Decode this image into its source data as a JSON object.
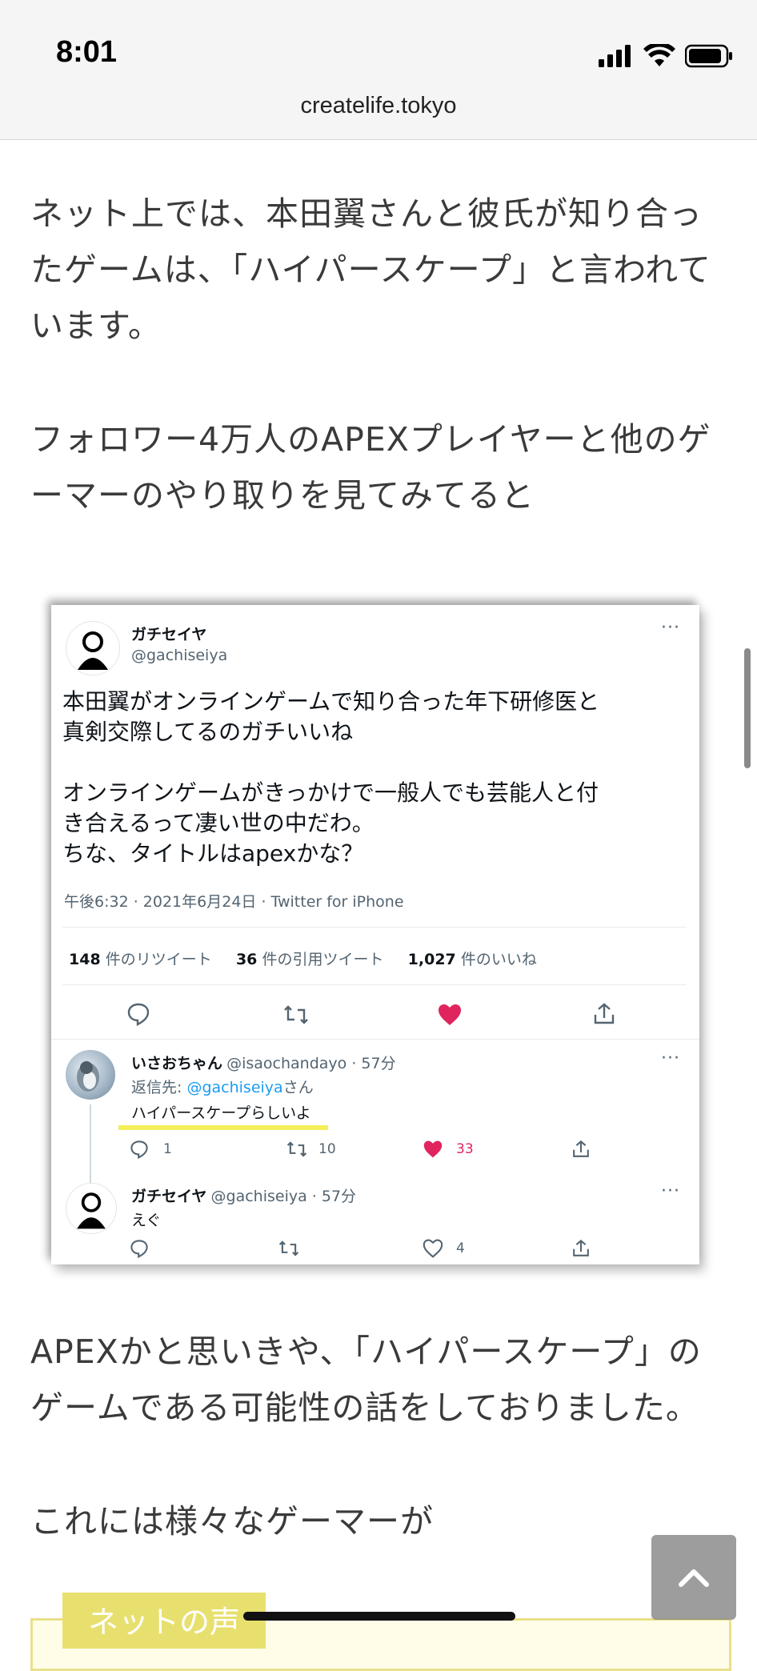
{
  "status_bar": {
    "time": "8:01",
    "battery_icon": "battery-icon",
    "wifi_icon": "wifi-icon",
    "signal_icon": "cellular-signal-icon"
  },
  "browser": {
    "url": "createlife.tokyo"
  },
  "article": {
    "para1": "ネット上では、本田翼さんと彼氏が知り合ったゲームは、「ハイパースケープ」と言われています。",
    "para2": "フォロワー4万人のAPEXプレイヤーと他のゲーマーのやり取りを見てみてると",
    "para3": "APEXかと思いきや、「ハイパースケープ」のゲームである可能性の話をしておりました。",
    "para4": "これには様々なゲーマーが"
  },
  "tweet": {
    "author_name": "ガチセイヤ",
    "author_handle": "@gachiseiya",
    "body_line1": "本田翼がオンラインゲームで知り合った年下研修医と",
    "body_line2": "真剣交際してるのガチいいね",
    "body_line3": "オンラインゲームがきっかけで一般人でも芸能人と付",
    "body_line4": "き合えるって凄い世の中だわ。",
    "body_line5": "ちな、タイトルはapexかな？",
    "meta": "午後6:32 · 2021年6月24日 · Twitter for iPhone",
    "retweets_count": "148",
    "retweets_label": "件のリツイート",
    "quotes_count": "36",
    "quotes_label": "件の引用ツイート",
    "likes_count": "1,027",
    "likes_label": "件のいいね",
    "like_color": "#e0245e"
  },
  "reply1": {
    "name": "いさおちゃん",
    "handle_time": "@isaochandayo · 57分",
    "replying_prefix": "返信先: ",
    "replying_to": "@gachiseiya",
    "replying_suffix": "さん",
    "text": "ハイパースケープらしいよ",
    "reply_count": "1",
    "retweet_count": "10",
    "like_count": "33",
    "highlight_color": "#f4ef5a"
  },
  "reply2": {
    "name": "ガチセイヤ",
    "handle_time": "@gachiseiya · 57分",
    "text": "えぐ",
    "like_count": "4"
  },
  "comment_box": {
    "label": "ネットの声"
  },
  "back_to_top": {
    "icon": "chevron-up-icon"
  }
}
